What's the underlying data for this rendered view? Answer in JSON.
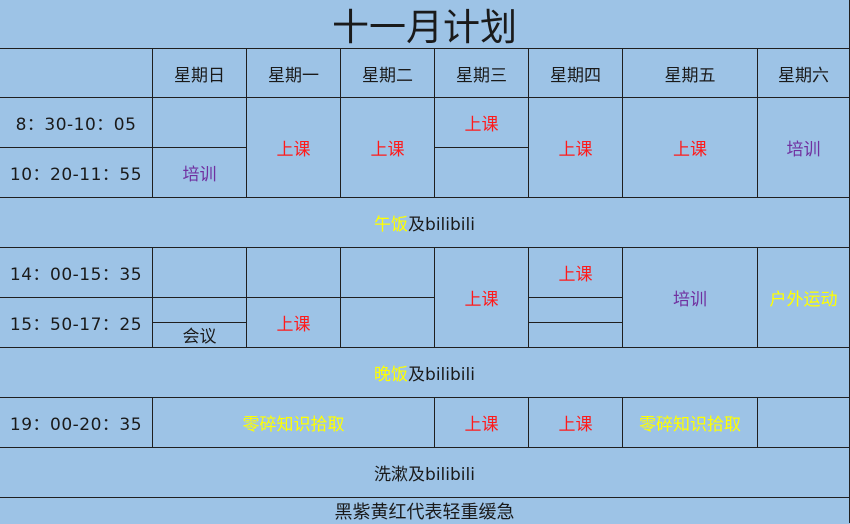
{
  "title": "十一月计划",
  "days": [
    "星期日",
    "星期一",
    "星期二",
    "星期三",
    "星期四",
    "星期五",
    "星期六"
  ],
  "times": {
    "t1": "8：30-10：05",
    "t2": "10：20-11：55",
    "t3": "14：00-15：35",
    "t4": "15：50-17：25",
    "t5": "19：00-20：35"
  },
  "activities": {
    "class": "上课",
    "training": "培训",
    "meeting": "会议",
    "outdoor": "户外运动",
    "fragments": "零碎知识拾取"
  },
  "breaks": {
    "lunch_part1": "午饭",
    "lunch_part2": "及bilibili",
    "dinner_part1": "晚饭",
    "dinner_part2": "及bilibili",
    "wash": "洗漱及bilibili"
  },
  "legend": "黑紫黄红代表轻重缓急",
  "colors": {
    "background": "#9dc3e6",
    "red": "#ff1a1a",
    "purple": "#7030a0",
    "yellow": "#ffff00",
    "grid": "#1f1f1f"
  }
}
